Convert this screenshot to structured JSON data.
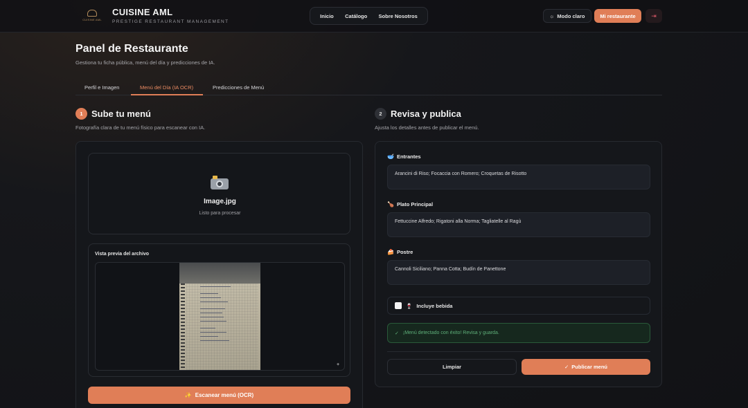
{
  "brand": {
    "title": "CUISINE AML",
    "subtitle": "PRESTIGE RESTAURANT MANAGEMENT",
    "logo_text": "CUISINE AML"
  },
  "nav": {
    "items": [
      "Inicio",
      "Catálogo",
      "Sobre Nosotros"
    ]
  },
  "header_actions": {
    "mode_label": "Modo claro",
    "mode_icon": "sun-icon",
    "restaurant_label": "Mi restaurante",
    "logout_icon": "logout-icon"
  },
  "page": {
    "title": "Panel de Restaurante",
    "subtitle": "Gestiona tu ficha pública, menú del día y predicciones de IA."
  },
  "tabs": [
    {
      "label": "Perfil e Imagen",
      "active": false
    },
    {
      "label": "Menú del Día (IA OCR)",
      "active": true
    },
    {
      "label": "Predicciones de Menú",
      "active": false
    }
  ],
  "upload": {
    "step": "1",
    "title": "Sube tu menú",
    "subtitle": "Fotografía clara de tu menú físico para escanear con IA.",
    "file_name": "Image.jpg",
    "file_status": "Listo para procesar",
    "preview_label": "Vista previa del archivo",
    "scan_button": "Escanear menú (OCR)",
    "scan_icon": "sparkles-icon"
  },
  "review": {
    "step": "2",
    "title": "Revisa y publica",
    "subtitle": "Ajusta los detalles antes de publicar el menú.",
    "fields": [
      {
        "label": "Entrantes",
        "icon": "bowl-icon",
        "value": "Arancini di Riso; Focaccia con Romero; Croquetas de Risotto"
      },
      {
        "label": "Plato Principal",
        "icon": "drumstick-icon",
        "value": "Fettuccine Alfredo; Rigatoni alla Norma; Tagliatelle al Ragù"
      },
      {
        "label": "Postre",
        "icon": "cake-icon",
        "value": "Cannoli Siciliano; Panna Cotta; Budín de Panettone"
      }
    ],
    "drink_label": "Incluye bebida",
    "drink_checked": false,
    "success_message": "¡Menú detectado con éxito! Revisa y guarda.",
    "clear_button": "Limpiar",
    "publish_button": "Publicar menú"
  },
  "colors": {
    "accent": "#e07e57",
    "success": "#5fb07a",
    "background": "#111215"
  }
}
